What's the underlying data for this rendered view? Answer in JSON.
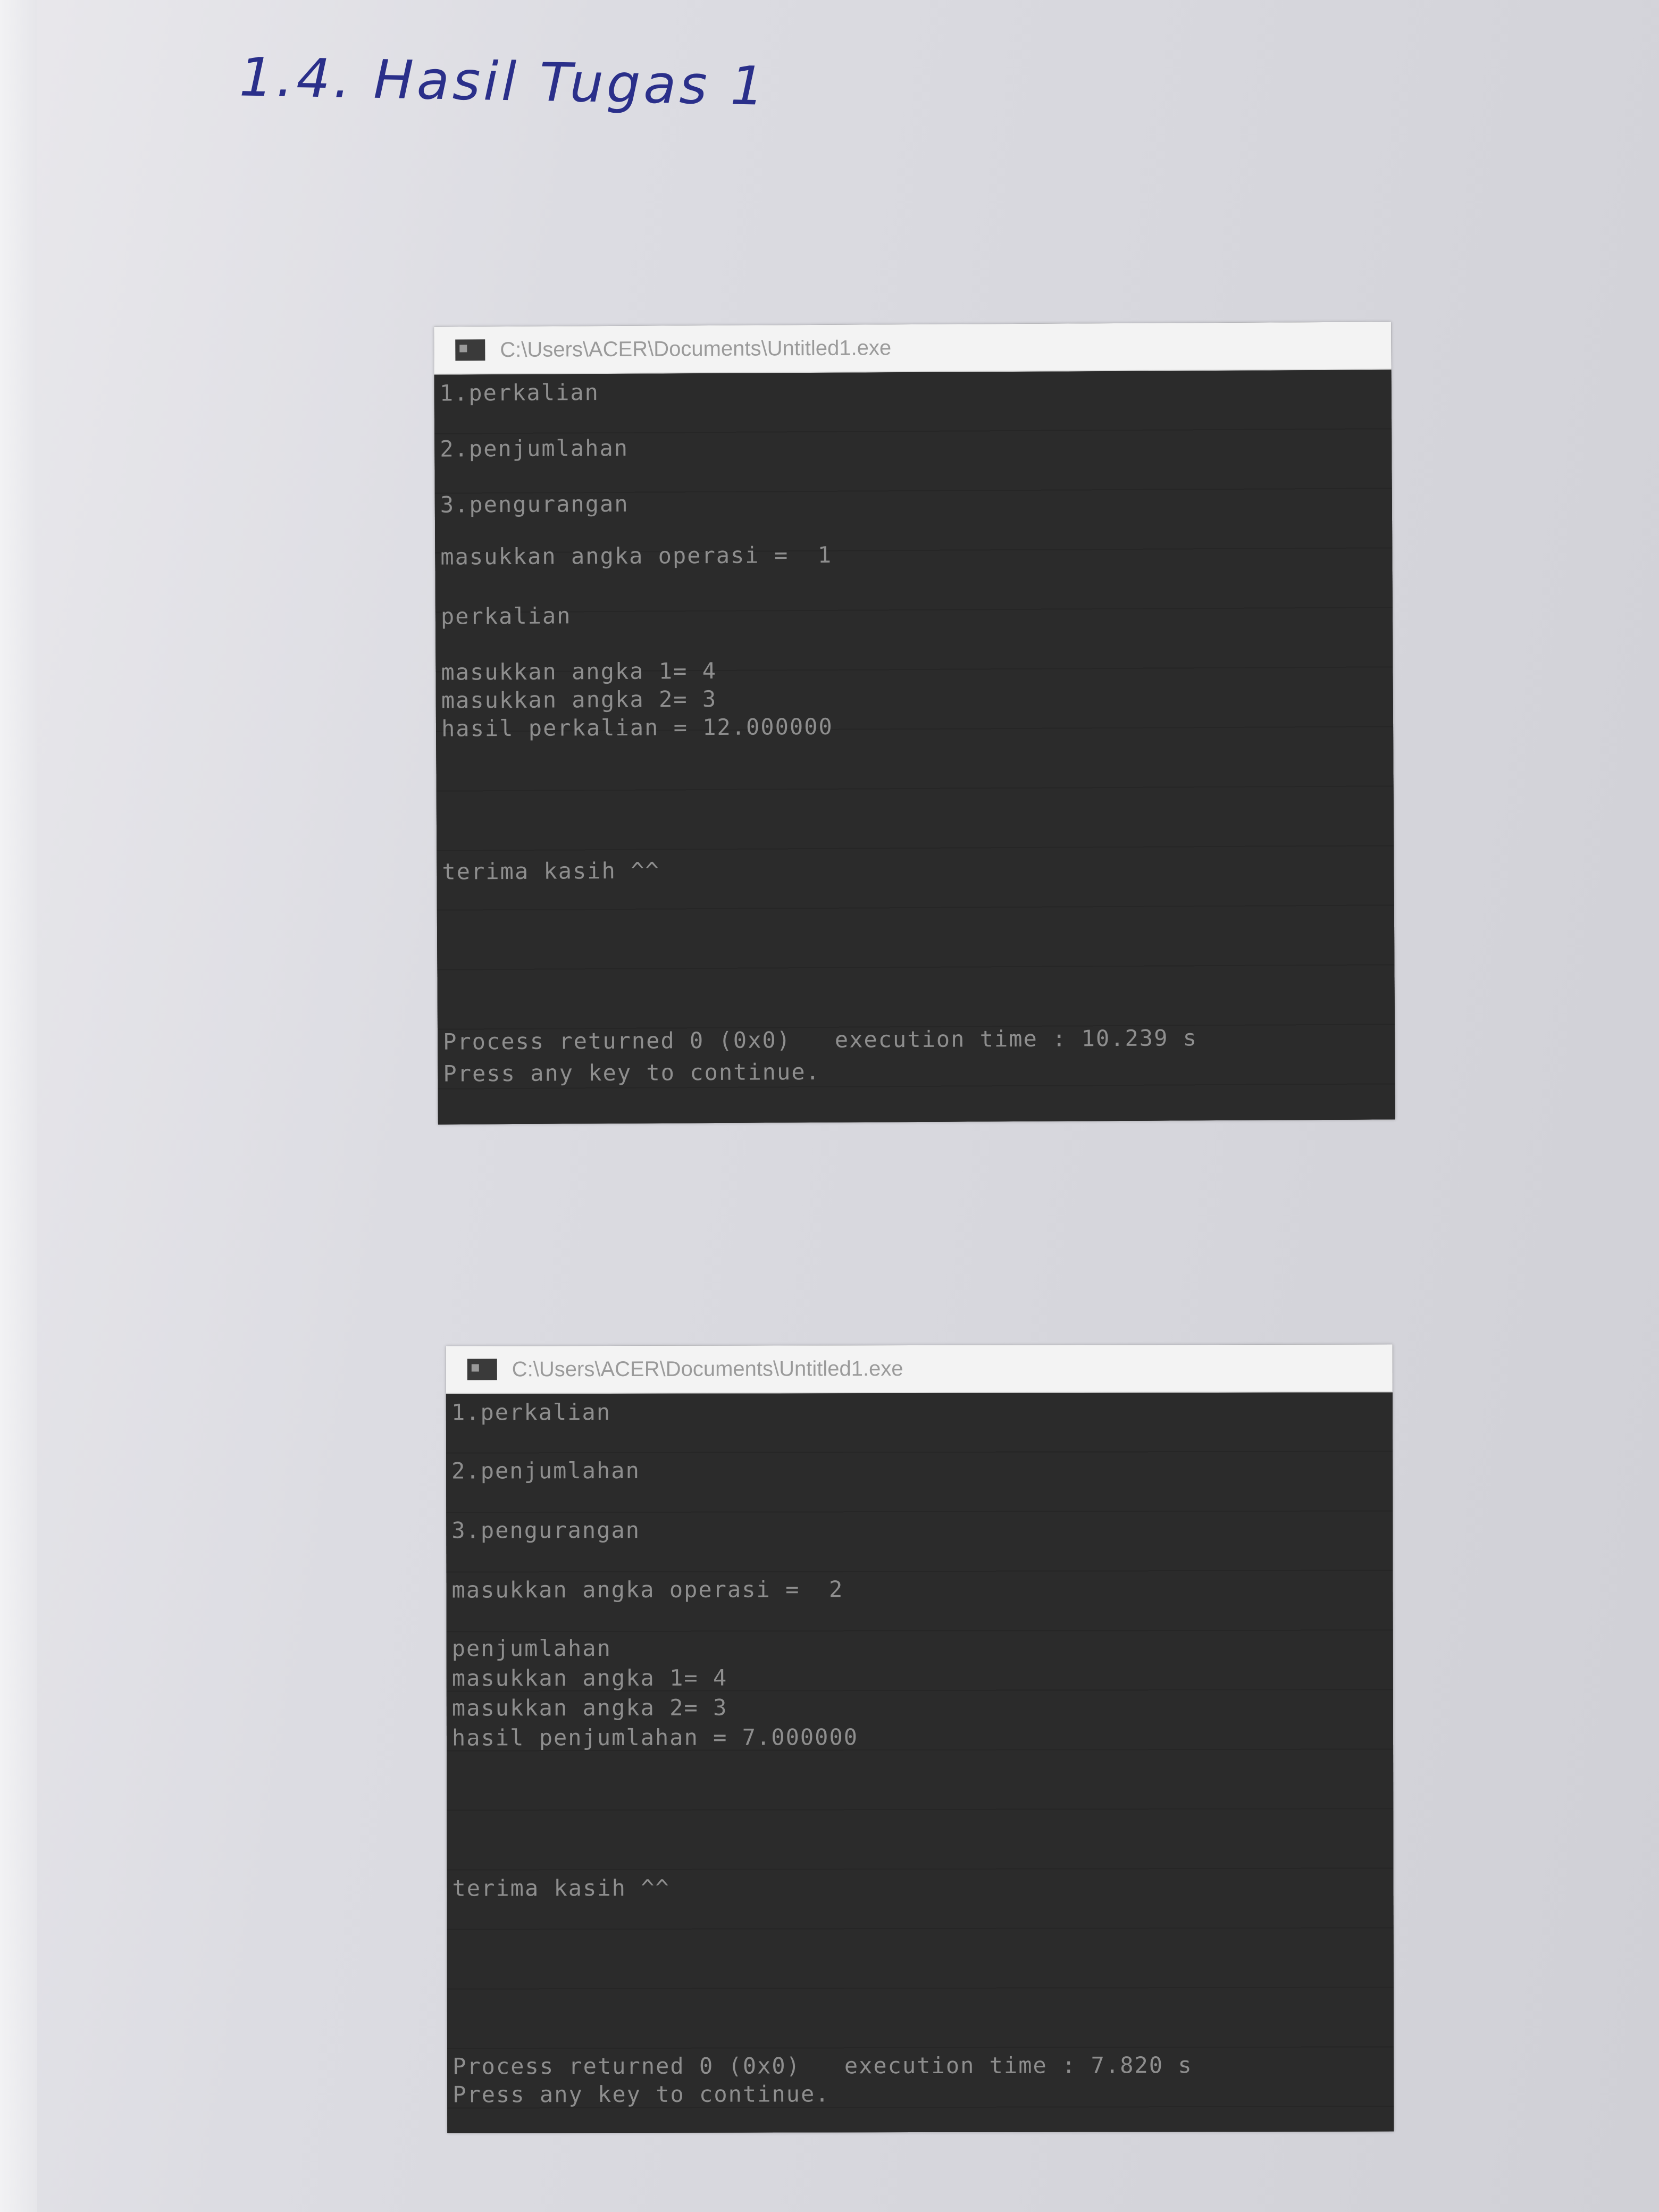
{
  "heading": "1.4. Hasil Tugas 1",
  "consoles": [
    {
      "title": "C:\\Users\\ACER\\Documents\\Untitled1.exe",
      "lines": [
        "1.perkalian",
        "2.penjumlahan",
        "3.pengurangan",
        "masukkan angka operasi =  1",
        "perkalian",
        "masukkan angka 1= 4",
        "masukkan angka 2= 3",
        "hasil perkalian = 12.000000",
        "terima kasih ^^",
        "Process returned 0 (0x0)   execution time : 10.239 s",
        "Press any key to continue."
      ]
    },
    {
      "title": "C:\\Users\\ACER\\Documents\\Untitled1.exe",
      "lines": [
        "1.perkalian",
        "2.penjumlahan",
        "3.pengurangan",
        "masukkan angka operasi =  2",
        "penjumlahan",
        "masukkan angka 1= 4",
        "masukkan angka 2= 3",
        "hasil penjumlahan = 7.000000",
        "terima kasih ^^",
        "Process returned 0 (0x0)   execution time : 7.820 s",
        "Press any key to continue."
      ]
    }
  ]
}
